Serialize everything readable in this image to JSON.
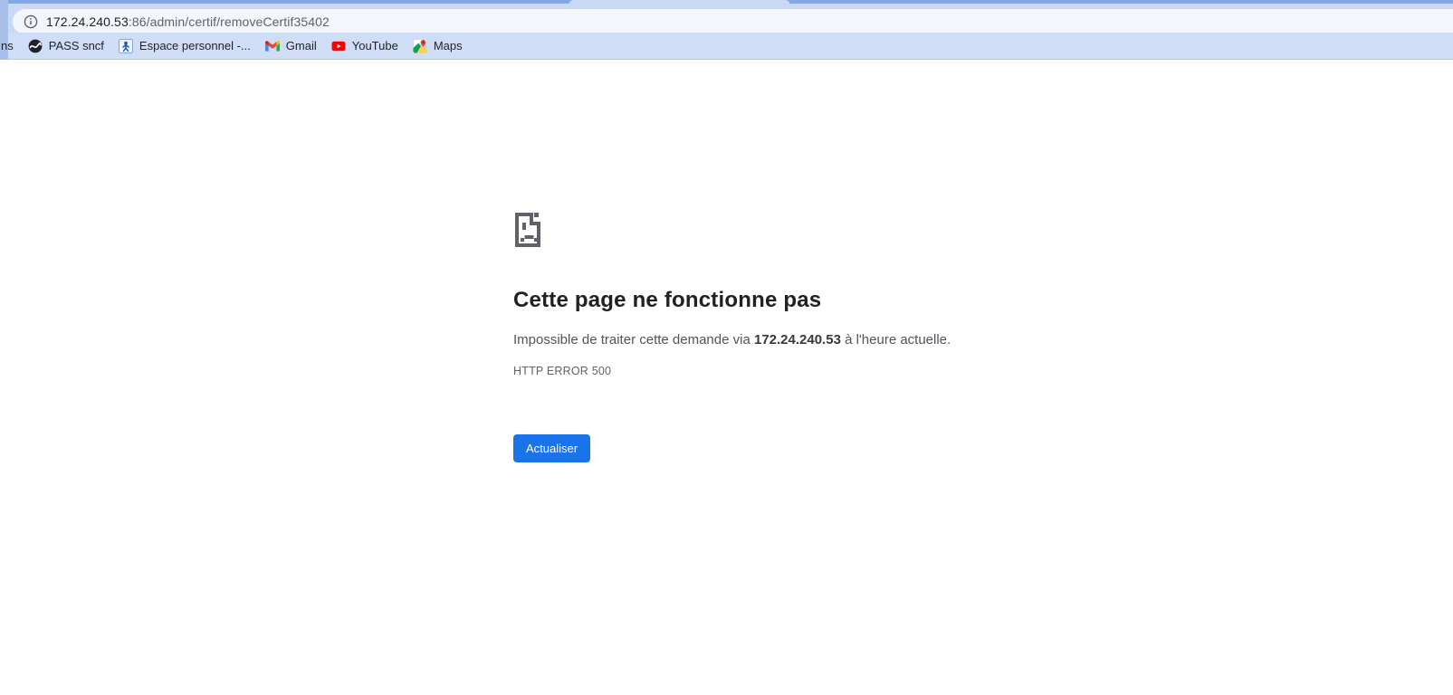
{
  "browser": {
    "omnibox": {
      "url_host": "172.24.240.53",
      "url_rest": ":86/admin/certif/removeCertif35402",
      "info_icon": "info-icon"
    },
    "bookmarks_bar": {
      "partial_item": {
        "label": "ns"
      },
      "items": [
        {
          "label": "PASS sncf",
          "icon": "globe-icon"
        },
        {
          "label": "Espace personnel -...",
          "icon": "person-icon"
        },
        {
          "label": "Gmail",
          "icon": "gmail-icon"
        },
        {
          "label": "YouTube",
          "icon": "youtube-icon"
        },
        {
          "label": "Maps",
          "icon": "maps-icon"
        }
      ]
    }
  },
  "error_page": {
    "icon": "sad-page-icon",
    "title": "Cette page ne fonctionne pas",
    "message_prefix": "Impossible de traiter cette demande via ",
    "message_host": "172.24.240.53",
    "message_suffix": " à l'heure actuelle.",
    "error_code": "HTTP ERROR 500",
    "reload_label": "Actualiser"
  },
  "colors": {
    "tab_strip": "#84a7e8",
    "toolbar": "#c9d9f4",
    "bookmarks_bar": "#cfddf6",
    "omnibox_bg": "#f3f6fb",
    "button_blue": "#1a73e8",
    "icon_gray": "#5f6368",
    "text_dark": "#202124",
    "text_gray": "#5f6368"
  }
}
